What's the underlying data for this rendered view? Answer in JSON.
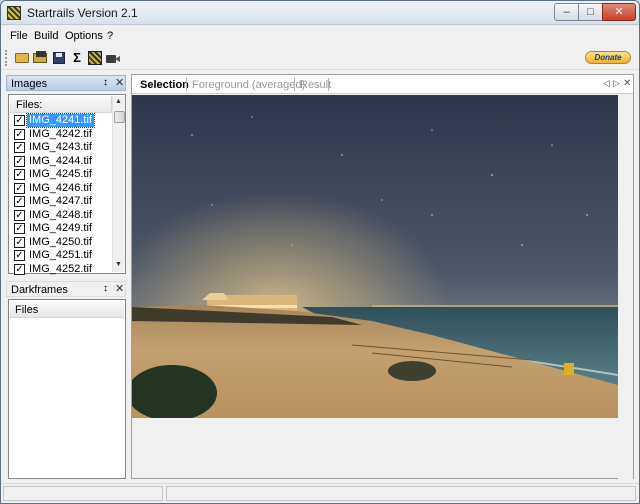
{
  "window": {
    "title": "Startrails Version 2.1",
    "buttons": {
      "minimize": "–",
      "maximize": "□",
      "close": "✕"
    }
  },
  "menu": [
    "File",
    "Build",
    "Options",
    "?"
  ],
  "toolbar": {
    "icons": [
      "open-folder-icon",
      "open-darkframes-icon",
      "save-icon",
      "sigma-icon",
      "startrails-icon",
      "video-icon"
    ],
    "sigma_glyph": "Σ",
    "donate_label": "Donate"
  },
  "images_panel": {
    "title": "Images",
    "pin_glyph": "↕",
    "close_glyph": "✕",
    "column_header": "Files:",
    "files": [
      {
        "name": "IMG_4241.tif",
        "checked": true,
        "selected": true
      },
      {
        "name": "IMG_4242.tif",
        "checked": true,
        "selected": false
      },
      {
        "name": "IMG_4243.tif",
        "checked": true,
        "selected": false
      },
      {
        "name": "IMG_4244.tif",
        "checked": true,
        "selected": false
      },
      {
        "name": "IMG_4245.tif",
        "checked": true,
        "selected": false
      },
      {
        "name": "IMG_4246.tif",
        "checked": true,
        "selected": false
      },
      {
        "name": "IMG_4247.tif",
        "checked": true,
        "selected": false
      },
      {
        "name": "IMG_4248.tif",
        "checked": true,
        "selected": false
      },
      {
        "name": "IMG_4249.tif",
        "checked": true,
        "selected": false
      },
      {
        "name": "IMG_4250.tif",
        "checked": true,
        "selected": false
      },
      {
        "name": "IMG_4251.tif",
        "checked": true,
        "selected": false
      },
      {
        "name": "IMG_4252.tif",
        "checked": true,
        "selected": false
      }
    ],
    "check_glyph": "✓"
  },
  "darkframes_panel": {
    "title": "Darkframes",
    "pin_glyph": "↕",
    "close_glyph": "✕",
    "column_header": "Files"
  },
  "document": {
    "tabs": [
      {
        "label": "Selection",
        "active": true
      },
      {
        "label": "Foreground (averaged)",
        "active": false
      },
      {
        "label": "Result",
        "active": false
      }
    ],
    "nav": {
      "prev": "◁",
      "next": "▷",
      "close": "✕"
    }
  },
  "colors": {
    "selection": "#3399ff",
    "close_button": "#c6412c",
    "donate": "#f1b02e"
  }
}
